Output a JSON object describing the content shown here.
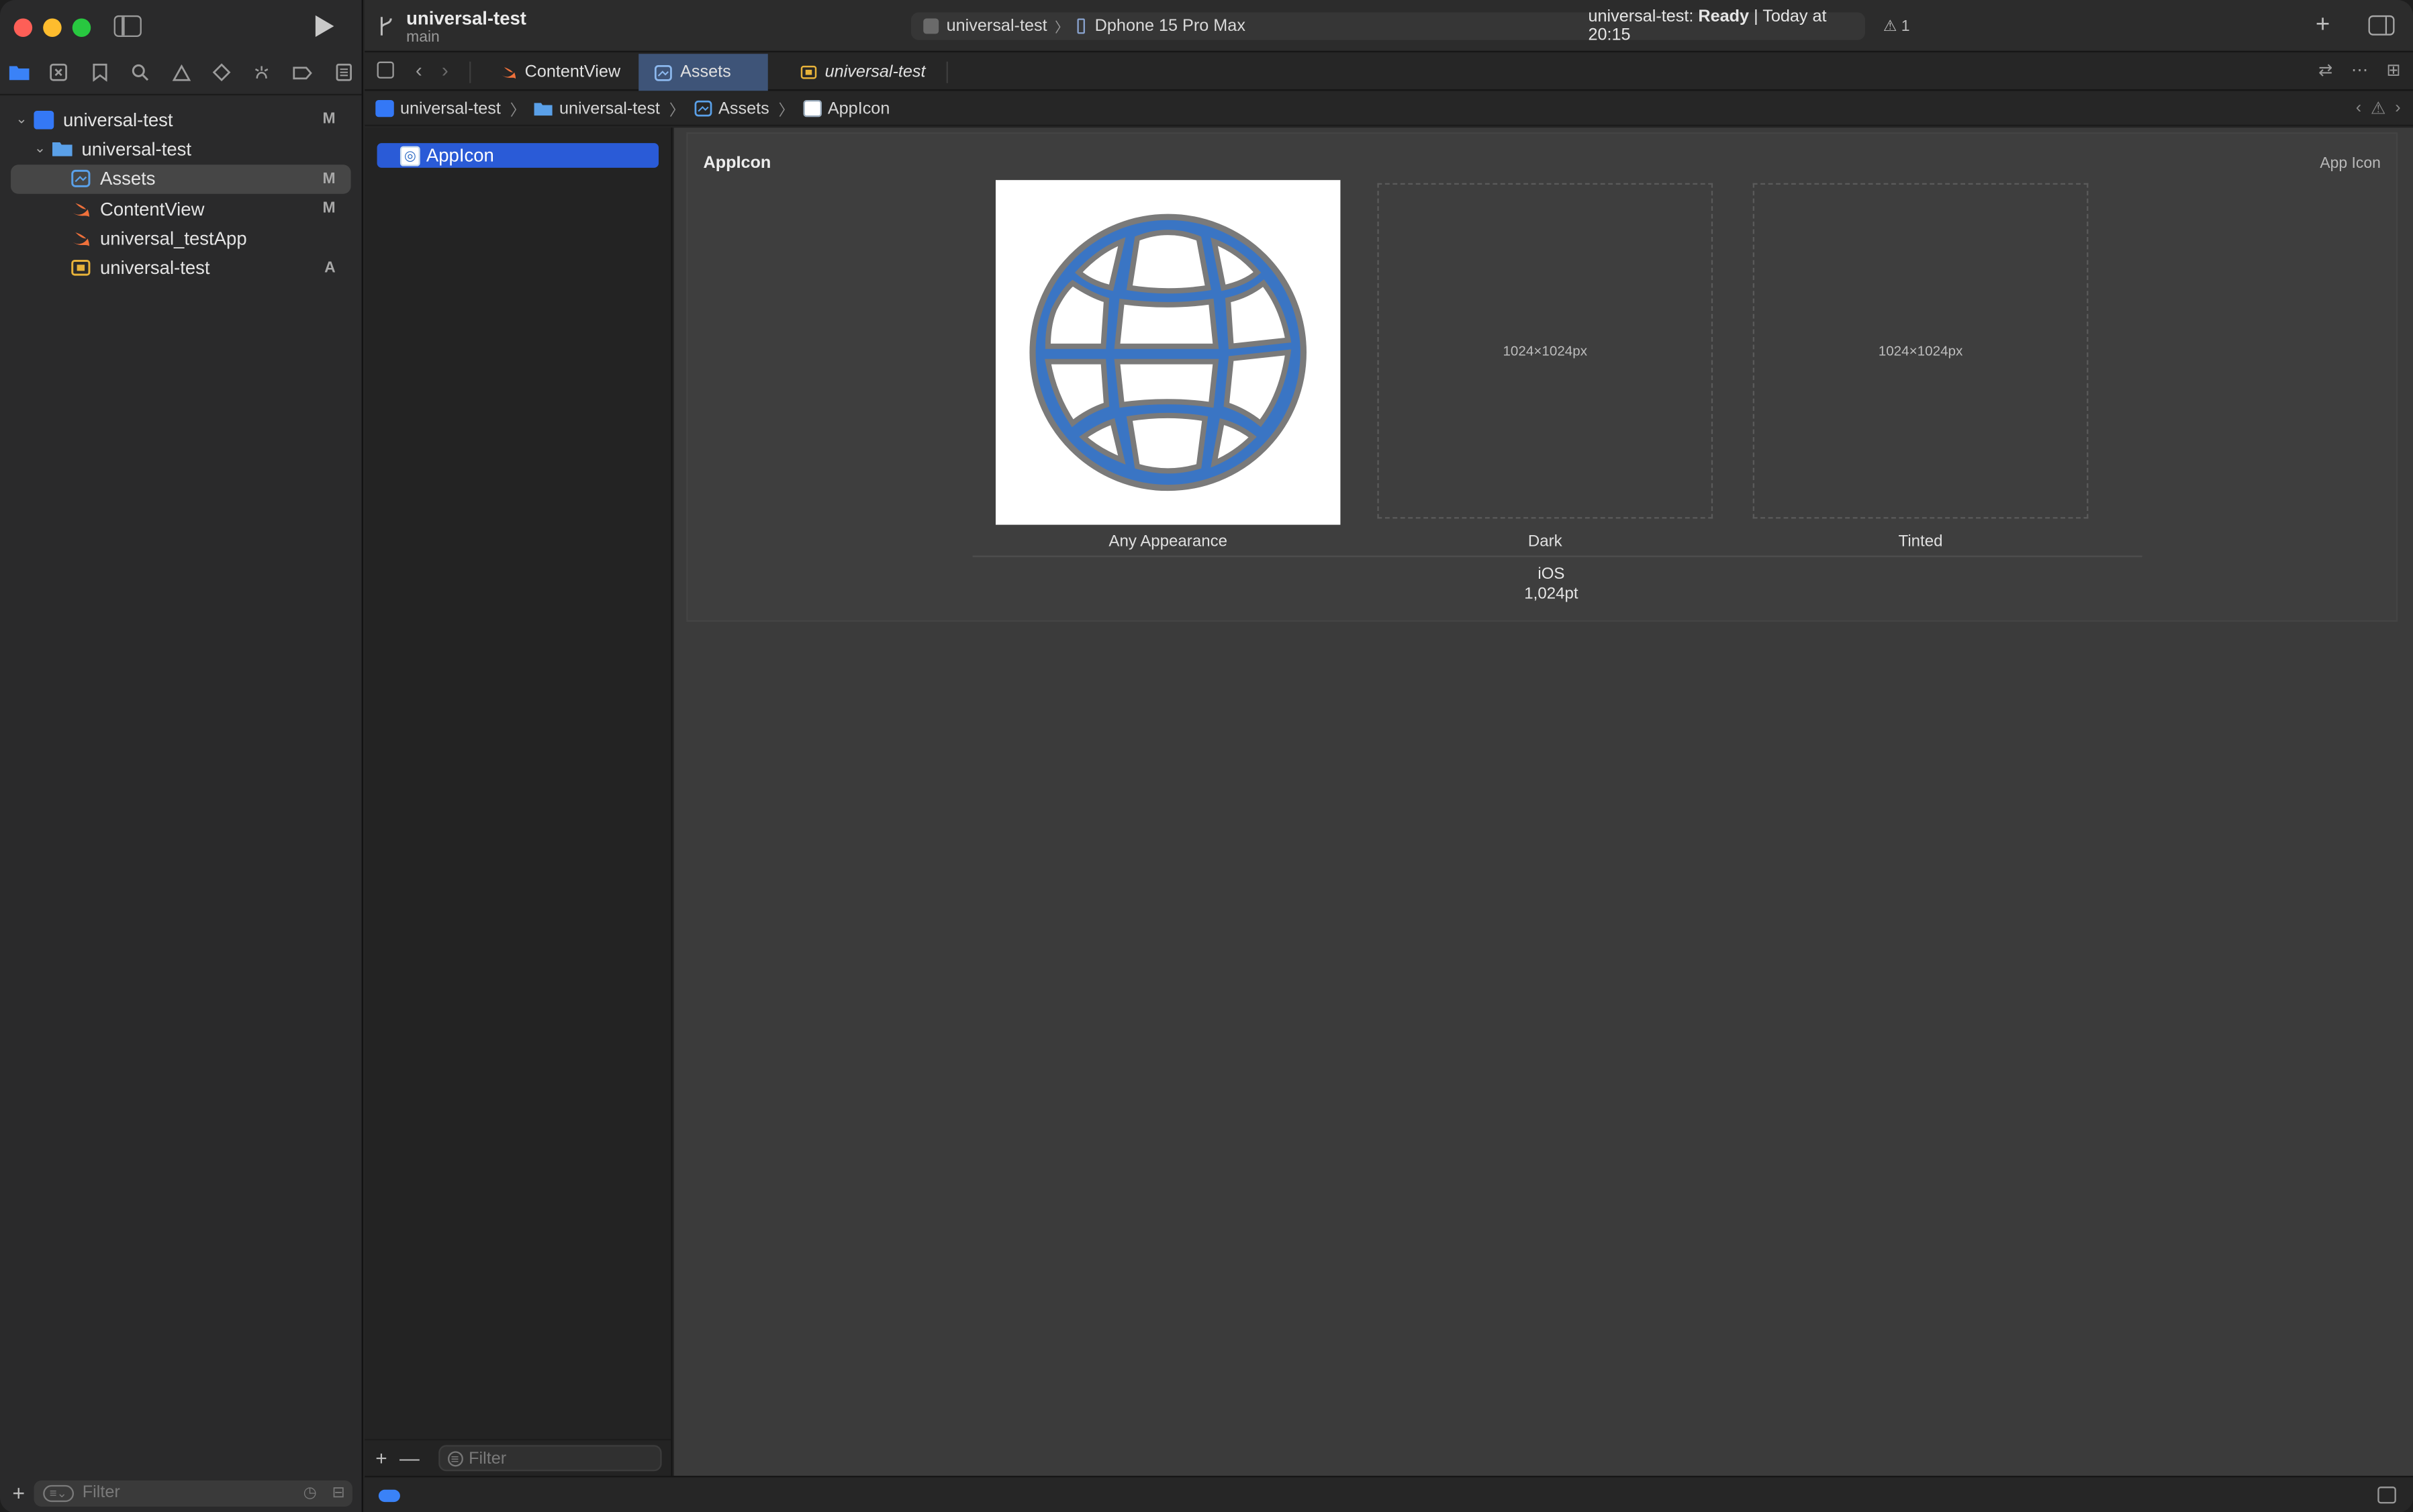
{
  "toolbar": {
    "project_title": "universal-test",
    "branch": "main",
    "scheme": "universal-test",
    "scheme_separator": "〉",
    "device": "Dphone 15 Pro Max",
    "status_prefix": "universal-test: ",
    "status_state": "Ready",
    "status_suffix": " | Today at 20:15",
    "warning_count": "1",
    "add_symbol": "+"
  },
  "navigator": {
    "tabs": [
      "folder-icon",
      "source-control-icon",
      "bookmark-icon",
      "find-icon",
      "issue-icon",
      "test-icon",
      "debug-icon",
      "breakpoint-icon",
      "report-icon"
    ],
    "tree": [
      {
        "label": "universal-test",
        "badge": "M",
        "icon": "project-icon"
      },
      {
        "label": "universal-test",
        "badge": "",
        "icon": "folder-icon"
      },
      {
        "label": "Assets",
        "badge": "M",
        "icon": "asset-catalog-icon"
      },
      {
        "label": "ContentView",
        "badge": "M",
        "icon": "swift-file-icon"
      },
      {
        "label": "universal_testApp",
        "badge": "",
        "icon": "swift-file-icon"
      },
      {
        "label": "universal-test",
        "badge": "A",
        "icon": "entitlements-icon"
      }
    ],
    "filter_placeholder": "Filter"
  },
  "tabs": [
    {
      "label": "ContentView",
      "icon": "swift-file-icon"
    },
    {
      "label": "Assets",
      "icon": "asset-catalog-icon"
    },
    {
      "label": "universal-test",
      "icon": "entitlements-icon"
    }
  ],
  "jumpbar": {
    "crumbs": [
      "universal-test",
      "universal-test",
      "Assets",
      "AppIcon"
    ],
    "separator": "〉"
  },
  "asset_list": {
    "items": [
      "AppIcon"
    ],
    "add_symbol": "+",
    "remove_symbol": "—",
    "filter_placeholder": "Filter"
  },
  "editor": {
    "set_name": "AppIcon",
    "set_type": "App Icon",
    "slots": [
      {
        "label": "Any Appearance",
        "size_hint": ""
      },
      {
        "label": "Dark",
        "size_hint": "1024×1024px"
      },
      {
        "label": "Tinted",
        "size_hint": "1024×1024px"
      }
    ],
    "platform": "iOS",
    "point_size": "1,024pt"
  },
  "colors": {
    "accent": "#2a5bd7",
    "globe_blue": "#3a75c4",
    "globe_outline": "#7a7a7a",
    "selection": "#464646"
  }
}
